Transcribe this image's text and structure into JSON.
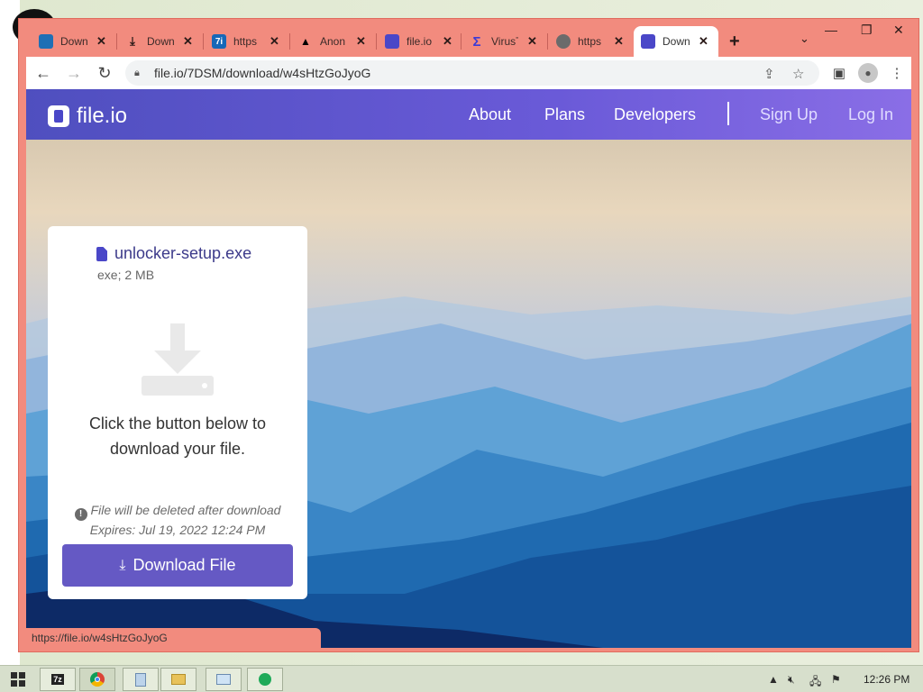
{
  "browser": {
    "tabs": [
      {
        "title": "Down",
        "icon": "page-icon",
        "active": false
      },
      {
        "title": "Down",
        "icon": "download-icon",
        "active": false
      },
      {
        "title": "https",
        "icon": "7i-icon",
        "active": false
      },
      {
        "title": "Anon",
        "icon": "anon-icon",
        "active": false
      },
      {
        "title": "file.io",
        "icon": "fileio-icon",
        "active": false
      },
      {
        "title": "VirusT",
        "icon": "virustotal-icon",
        "active": false
      },
      {
        "title": "https",
        "icon": "globe-icon",
        "active": false
      },
      {
        "title": "Down",
        "icon": "fileio-icon",
        "active": true
      }
    ],
    "url": "file.io/7DSM/download/w4sHtzGoJyoG",
    "status_url": "https://file.io/w4sHtzGoJyoG"
  },
  "site": {
    "brand": "file.io",
    "nav": {
      "about": "About",
      "plans": "Plans",
      "developers": "Developers",
      "signup": "Sign Up",
      "login": "Log In"
    }
  },
  "card": {
    "filename": "unlocker-setup.exe",
    "meta": "exe; 2 MB",
    "message_line1": "Click the button below to",
    "message_line2": "download your file.",
    "warning": "File will be deleted after download",
    "expires": "Expires: Jul 19, 2022 12:24 PM",
    "button": "Download File"
  },
  "taskbar": {
    "apps": [
      "7z",
      "chrome",
      "notepad",
      "explorer",
      "image-viewer",
      "shield"
    ],
    "clock": "12:26 PM"
  },
  "colors": {
    "accent": "#6559c4",
    "header_start": "#4f4fbf",
    "header_end": "#8a6ee6",
    "window_frame": "#f28b7e"
  }
}
